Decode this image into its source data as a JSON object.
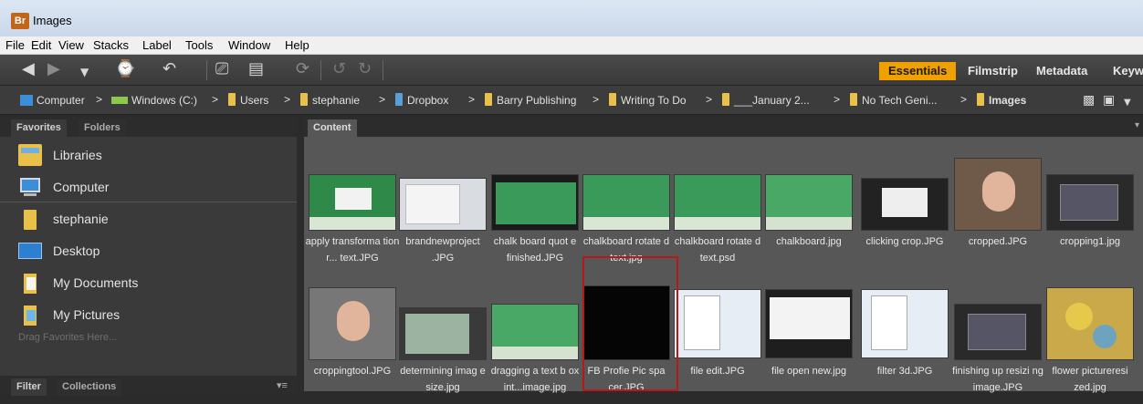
{
  "window": {
    "app_badge": "Br",
    "title": "Images"
  },
  "menu": [
    "File",
    "Edit",
    "View",
    "Stacks",
    "Label",
    "Tools",
    "Window",
    "Help"
  ],
  "workspaces": [
    "Essentials",
    "Filmstrip",
    "Metadata",
    "Keyw"
  ],
  "path": [
    "Computer",
    "Windows (C:)",
    "Users",
    "stephanie",
    "Dropbox",
    "Barry Publishing",
    "Writing To Do",
    "___January 2...",
    "No Tech Geni...",
    "Images"
  ],
  "left_panel": {
    "tabs": [
      "Favorites",
      "Folders"
    ],
    "items": [
      "Libraries",
      "Computer",
      "stephanie",
      "Desktop",
      "My Documents",
      "My Pictures"
    ],
    "drag_hint": "Drag Favorites Here...",
    "bottom_tabs": [
      "Filter",
      "Collections"
    ]
  },
  "content": {
    "tab": "Content",
    "row1": [
      {
        "label": "apply transforma tion r... text.JPG",
        "kind": "green-dialog"
      },
      {
        "label": "brandnewproject .JPG",
        "kind": "dialog-light"
      },
      {
        "label": "chalk board quot e finished.JPG",
        "kind": "green-dark"
      },
      {
        "label": "chalkboard rotate d text.jpg",
        "kind": "green"
      },
      {
        "label": "chalkboard rotate d text.psd",
        "kind": "green"
      },
      {
        "label": "chalkboard.jpg",
        "kind": "green-plain"
      },
      {
        "label": "clicking crop.JPG",
        "kind": "dark-dialog"
      },
      {
        "label": "cropped.JPG",
        "kind": "face"
      },
      {
        "label": "cropping1.jpg",
        "kind": "screen-dark"
      }
    ],
    "row2": [
      {
        "label": "croppingtool.JPG",
        "kind": "face-gray"
      },
      {
        "label": "determining imag e size.jpg",
        "kind": "screen-light"
      },
      {
        "label": "dragging a text b ox int...image.jpg",
        "kind": "green-plain"
      },
      {
        "label": "FB Profie Pic spa cer.JPG",
        "kind": "black"
      },
      {
        "label": "file edit.JPG",
        "kind": "menu-light"
      },
      {
        "label": "file open new.jpg",
        "kind": "menu-dark"
      },
      {
        "label": "filter 3d.JPG",
        "kind": "menu-light"
      },
      {
        "label": "finishing up resizi ng image.JPG",
        "kind": "screen-dark"
      },
      {
        "label": "flower pictureresi zed.jpg",
        "kind": "flower"
      }
    ]
  },
  "colors": {
    "accent": "#f0a100",
    "selection": "#b81818",
    "panel": "#3a3a3a",
    "content_bg": "#575757"
  }
}
